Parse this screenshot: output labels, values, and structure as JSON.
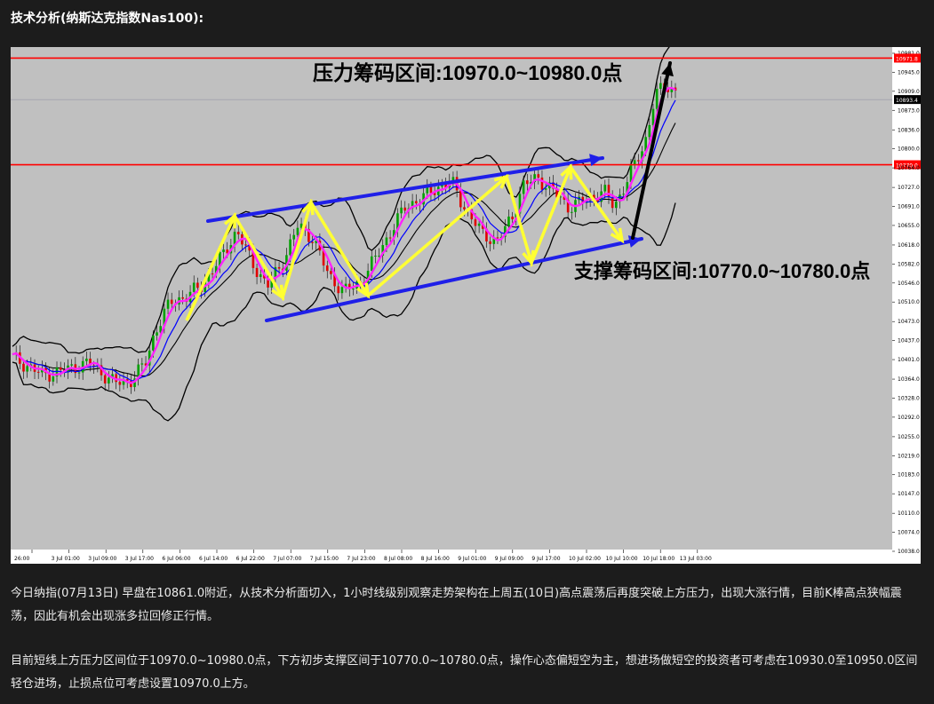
{
  "heading": "技术分析(纳斯达克指数Nas100):",
  "chart_data": {
    "type": "candlestick",
    "resistance_label": "压力筹码区间:10970.0~10980.0点",
    "support_label": "支撑筹码区间:10770.0~10780.0点",
    "resistance_level": 10971.8,
    "support_level": 10770.0,
    "current_price": 10893.4,
    "price_axis_labels": [
      "10981.0",
      "10971.8",
      "10945.0",
      "10909.0",
      "10893.4",
      "10873.0",
      "10836.0",
      "10800.0",
      "10770.0",
      "10764.0",
      "10727.0",
      "10691.0",
      "10655.0",
      "10618.0",
      "10582.0",
      "10546.0",
      "10510.0",
      "10473.0",
      "10437.0",
      "10401.0",
      "10364.0",
      "10328.0",
      "10292.0",
      "10255.0",
      "10219.0",
      "10183.0",
      "10147.0",
      "10110.0",
      "10074.0",
      "10038.0"
    ],
    "time_axis_labels": [
      "26:00",
      "3 Jul 01:00",
      "3 Jul 09:00",
      "3 Jul 17:00",
      "6 Jul 06:00",
      "6 Jul 14:00",
      "6 Jul 22:00",
      "7 Jul 07:00",
      "7 Jul 15:00",
      "7 Jul 23:00",
      "8 Jul 08:00",
      "8 Jul 16:00",
      "9 Jul 01:00",
      "9 Jul 09:00",
      "9 Jul 17:00",
      "10 Jul 02:00",
      "10 Jul 10:00",
      "10 Jul 18:00",
      "13 Jul 03:00"
    ],
    "colors": {
      "background": "#c0c0c0",
      "level_line": "#ff0000",
      "channel_arrow": "#1f1fe8",
      "zigzag": "#ffff33",
      "ma_fast": "#ff22ff",
      "ma_slow": "#0000ff",
      "bollinger": "#000000",
      "candle_up": "#00a000",
      "candle_down": "#e00000"
    }
  },
  "paragraphs": {
    "p1": "今日纳指(07月13日) 早盘在10861.0附近，从技术分析面切入，1小时线级别观察走势架构在上周五(10日)高点震荡后再度突破上方压力，出现大涨行情，目前K棒高点狭幅震荡，因此有机会出现涨多拉回修正行情。",
    "p2": "目前短线上方压力区间位于10970.0~10980.0点，下方初步支撑区间于10770.0~10780.0点，操作心态偏短空为主，想进场做短空的投资者可考虑在10930.0至10950.0区间轻仓进场，止损点位可考虑设置10970.0上方。"
  }
}
